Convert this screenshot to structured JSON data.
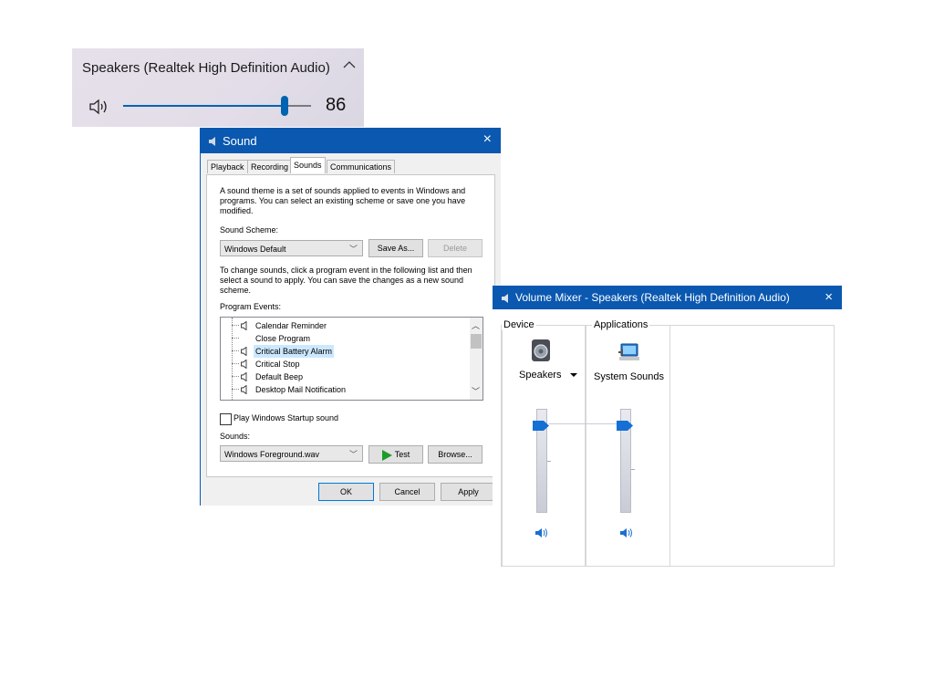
{
  "flyout": {
    "device_name": "Speakers (Realtek High Definition Audio)",
    "volume_value": "86",
    "volume_fraction": 0.86,
    "accent_color": "#0063b1"
  },
  "sound_dialog": {
    "title": "Sound",
    "close": "×",
    "tabs": [
      "Playback",
      "Recording",
      "Sounds",
      "Communications"
    ],
    "active_tab": "Sounds",
    "description": "A sound theme is a set of sounds applied to events in Windows and programs.  You can select an existing scheme or save one you have modified.",
    "scheme_label": "Sound Scheme:",
    "scheme_value": "Windows Default",
    "save_as": "Save As...",
    "delete": "Delete",
    "change_text": "To change sounds, click a program event in the following list and then select a sound to apply.  You can save the changes as a new sound scheme.",
    "events_label": "Program Events:",
    "events": [
      {
        "label": "Calendar Reminder",
        "has_sound": true
      },
      {
        "label": "Close Program",
        "has_sound": false
      },
      {
        "label": "Critical Battery Alarm",
        "has_sound": true,
        "selected": true
      },
      {
        "label": "Critical Stop",
        "has_sound": true
      },
      {
        "label": "Default Beep",
        "has_sound": true
      },
      {
        "label": "Desktop Mail Notification",
        "has_sound": true
      }
    ],
    "startup_checkbox": "Play Windows Startup sound",
    "startup_checked": false,
    "sounds_label": "Sounds:",
    "sound_value": "Windows Foreground.wav",
    "test": "Test",
    "browse": "Browse...",
    "ok": "OK",
    "cancel": "Cancel",
    "apply": "Apply",
    "title_color": "#0a58b0"
  },
  "mixer": {
    "title": "Volume Mixer - Speakers (Realtek High Definition Audio)",
    "close": "×",
    "device_group": "Device",
    "applications_group": "Applications",
    "device_name": "Speakers",
    "app_name": "System Sounds",
    "device_level": 0.86,
    "app_level": 0.86
  }
}
